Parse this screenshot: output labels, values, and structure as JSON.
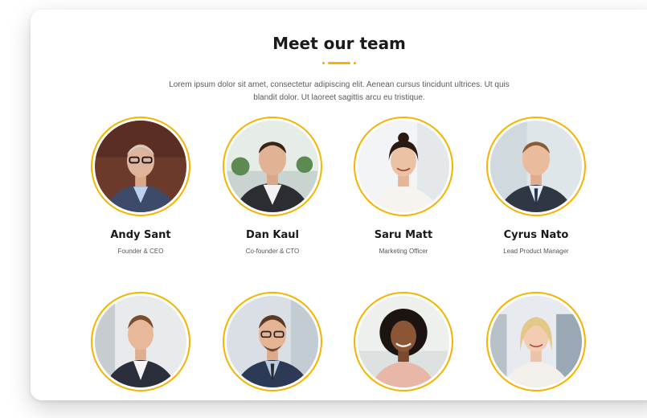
{
  "section": {
    "title": "Meet our team",
    "description": "Lorem ipsum dolor sit amet, consectetur adipiscing elit. Aenean cursus tincidunt ultrices. Ut quis blandit dolor. Ut laoreet sagittis arcu eu tristique."
  },
  "colors": {
    "accent": "#f4b400"
  },
  "team": [
    {
      "name": "Andy Sant",
      "role": "Founder & CEO"
    },
    {
      "name": "Dan Kaul",
      "role": "Co-founder & CTO"
    },
    {
      "name": "Saru Matt",
      "role": "Marketing Officer"
    },
    {
      "name": "Cyrus Nato",
      "role": "Lead Product Manager"
    },
    {
      "name": "",
      "role": ""
    },
    {
      "name": "",
      "role": ""
    },
    {
      "name": "",
      "role": ""
    },
    {
      "name": "",
      "role": ""
    }
  ]
}
